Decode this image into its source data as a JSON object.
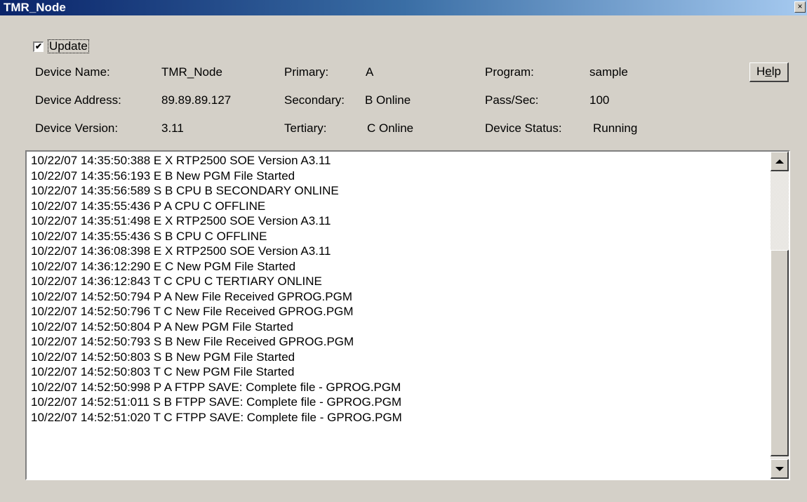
{
  "window": {
    "title": "TMR_Node",
    "close_symbol": "×"
  },
  "update": {
    "checked": true,
    "check_mark": "✔",
    "label": "Update"
  },
  "device": {
    "name_label": "Device Name:",
    "name_value": "TMR_Node",
    "address_label": "Device Address:",
    "address_value": "89.89.89.127",
    "version_label": "Device Version:",
    "version_value": "3.11"
  },
  "processors": {
    "primary_label": "Primary:",
    "primary_value": "A",
    "secondary_label": "Secondary:",
    "secondary_value": "B Online",
    "tertiary_label": "Tertiary:",
    "tertiary_value": "C Online"
  },
  "program": {
    "program_label": "Program:",
    "program_value": "sample",
    "pass_label": "Pass/Sec:",
    "pass_value": "100",
    "status_label": "Device Status:",
    "status_value": "Running"
  },
  "help": {
    "label_prefix": "H",
    "label_underlined": "e",
    "label_suffix": "lp"
  },
  "log": [
    "10/22/07 14:35:50:388 E X RTP2500 SOE Version A3.11",
    "10/22/07 14:35:56:193 E B New PGM File Started",
    "10/22/07 14:35:56:589 S B CPU B SECONDARY ONLINE",
    "10/22/07 14:35:55:436 P A CPU C OFFLINE",
    "10/22/07 14:35:51:498 E X RTP2500 SOE Version A3.11",
    "10/22/07 14:35:55:436 S B CPU C OFFLINE",
    "10/22/07 14:36:08:398 E X RTP2500 SOE Version A3.11",
    "10/22/07 14:36:12:290 E C New PGM File Started",
    "10/22/07 14:36:12:843 T C CPU C TERTIARY ONLINE",
    "10/22/07 14:52:50:794 P A New File Received GPROG.PGM",
    "10/22/07 14:52:50:796 T C New File Received GPROG.PGM",
    "10/22/07 14:52:50:804 P A New PGM File Started",
    "10/22/07 14:52:50:793 S B New File Received GPROG.PGM",
    "10/22/07 14:52:50:803 S B New PGM File Started",
    "10/22/07 14:52:50:803 T C New PGM File Started",
    "10/22/07 14:52:50:998 P A FTPP SAVE: Complete file - GPROG.PGM",
    "10/22/07 14:52:51:011 S B FTPP SAVE: Complete file - GPROG.PGM",
    "10/22/07 14:52:51:020 T C FTPP SAVE: Complete file - GPROG.PGM"
  ]
}
